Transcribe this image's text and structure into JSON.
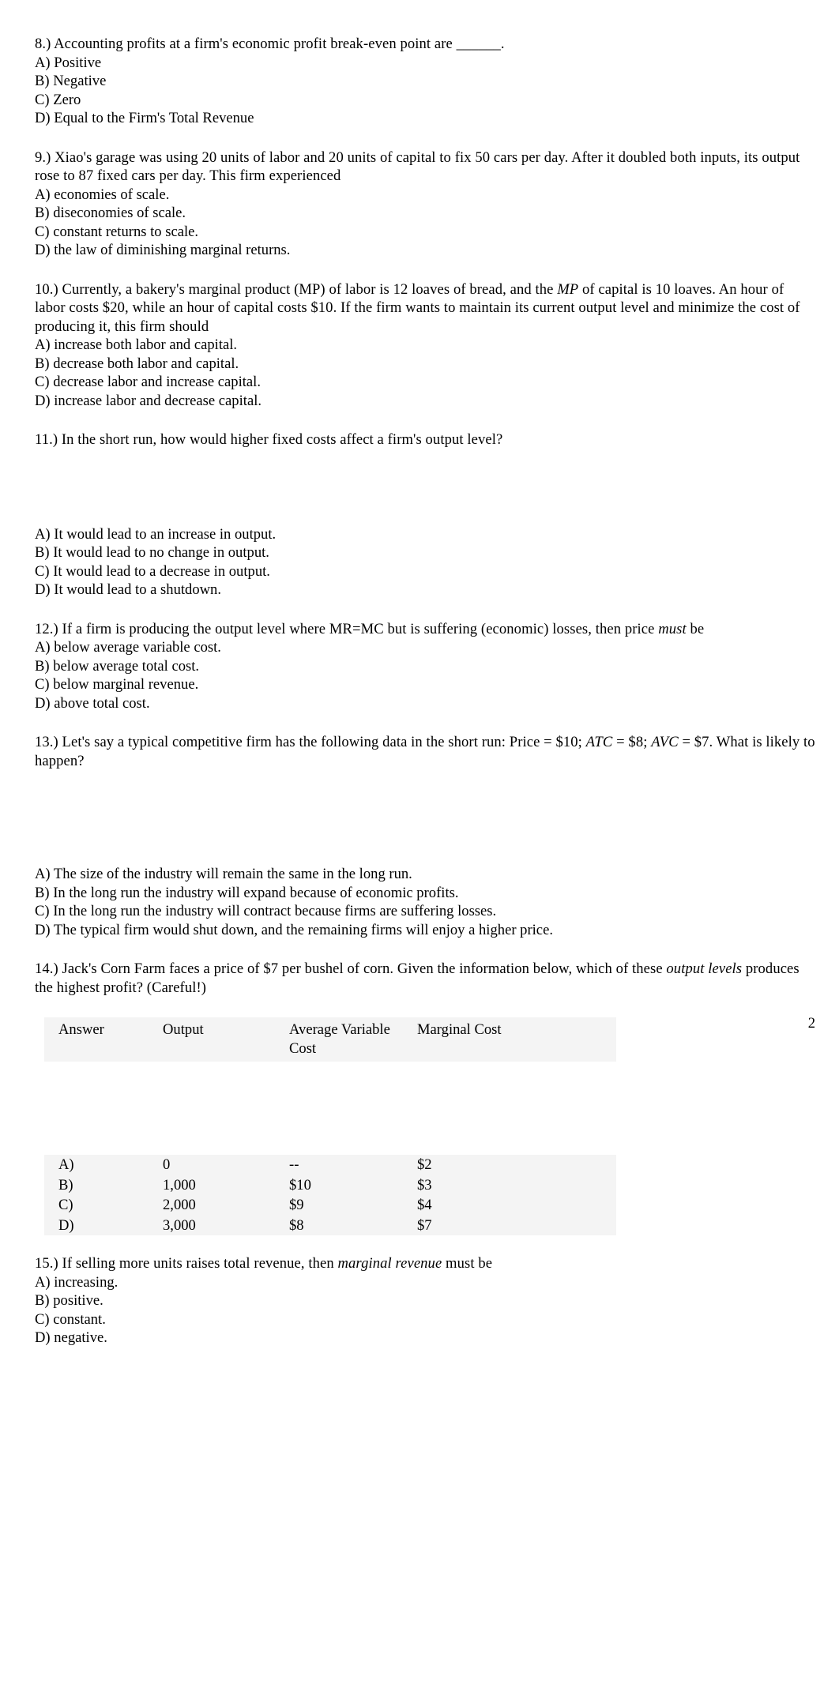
{
  "document": {
    "page_number": "2"
  },
  "questions": [
    {
      "id": "q8",
      "stem_parts": [
        {
          "text": "8.) Accounting profits at a firm's economic profit break-even point are ______.",
          "italic": false
        }
      ],
      "choices": [
        "A) Positive",
        "B) Negative",
        "C) Zero",
        "D) Equal to the Firm's Total Revenue"
      ]
    },
    {
      "id": "q9",
      "stem_parts": [
        {
          "text": "9.) Xiao's garage was using 20 units of labor and 20 units of capital to fix 50 cars per day. After it doubled both inputs, its output rose to 87 fixed cars per day. This firm experienced",
          "italic": false
        }
      ],
      "choices": [
        "A) economies of scale.",
        "B) diseconomies of scale.",
        "C) constant returns to scale.",
        "D) the law of diminishing marginal returns."
      ]
    },
    {
      "id": "q10",
      "stem_parts": [
        {
          "text": "10.) Currently, a bakery's marginal product (MP) of labor is 12 loaves of bread, and the ",
          "italic": false
        },
        {
          "text": "MP",
          "italic": true
        },
        {
          "text": " of capital is 10 loaves. An hour of labor costs $20, while an hour of capital costs $10. If the firm wants to maintain its current output level and minimize the cost of producing it, this firm should",
          "italic": false
        }
      ],
      "choices": [
        "A) increase both labor and capital.",
        "B) decrease both labor and capital.",
        "C) decrease labor and increase capital.",
        "D) increase labor and decrease capital."
      ]
    },
    {
      "id": "q11",
      "stem_parts": [
        {
          "text": "11.) In the short run, how would higher fixed costs affect a firm's output level?",
          "italic": false
        }
      ],
      "choices": [
        "A) It would lead to an increase in output.",
        "B) It would lead to no change in output.",
        "C) It would lead to a decrease in output.",
        "D) It would lead to a shutdown."
      ]
    },
    {
      "id": "q12",
      "stem_parts": [
        {
          "text": "12.) If a firm is producing the output level where MR=MC but is suffering (economic) losses, then price ",
          "italic": false
        },
        {
          "text": "must",
          "italic": true
        },
        {
          "text": " be",
          "italic": false
        }
      ],
      "choices": [
        "A) below average variable cost.",
        "B) below average total cost.",
        "C) below marginal revenue.",
        "D) above total cost."
      ]
    },
    {
      "id": "q13",
      "stem_parts": [
        {
          "text": "13.) Let's say a typical competitive firm has the following data in the short run: Price = $10; ",
          "italic": false
        },
        {
          "text": "ATC",
          "italic": true
        },
        {
          "text": " = $8; ",
          "italic": false
        },
        {
          "text": "AVC",
          "italic": true
        },
        {
          "text": " = $7. What is likely to happen?",
          "italic": false
        }
      ],
      "choices": [
        "A) The size of the industry will remain the same in the long run.",
        "B) In the long run the industry will expand because of economic profits.",
        "C) In the long run the industry will contract because firms are suffering losses.",
        "D) The typical firm would shut down, and the remaining firms will enjoy a higher price."
      ]
    },
    {
      "id": "q14",
      "stem_parts": [
        {
          "text": "14.) Jack's Corn Farm faces a price of $7 per bushel of corn. Given the information below, which of these ",
          "italic": false
        },
        {
          "text": "output levels",
          "italic": true
        },
        {
          "text": " produces the highest profit? (Careful!)",
          "italic": false
        }
      ],
      "choices": []
    },
    {
      "id": "q15",
      "stem_parts": [
        {
          "text": "15.) If selling more units raises total revenue, then ",
          "italic": false
        },
        {
          "text": "marginal revenue",
          "italic": true
        },
        {
          "text": " must be",
          "italic": false
        }
      ],
      "choices": [
        "A) increasing.",
        "B) positive.",
        "C) constant.",
        "D) negative."
      ]
    }
  ],
  "cost_table": {
    "headers": [
      "Answer",
      "Output",
      "Average Variable Cost",
      "Marginal Cost"
    ],
    "rows": [
      [
        "A)",
        "0",
        "--",
        "$2"
      ],
      [
        "B)",
        "1,000",
        "$10",
        "$3"
      ],
      [
        "C)",
        "2,000",
        "$9",
        "$4"
      ],
      [
        "D)",
        "3,000",
        "$8",
        "$7"
      ]
    ]
  }
}
